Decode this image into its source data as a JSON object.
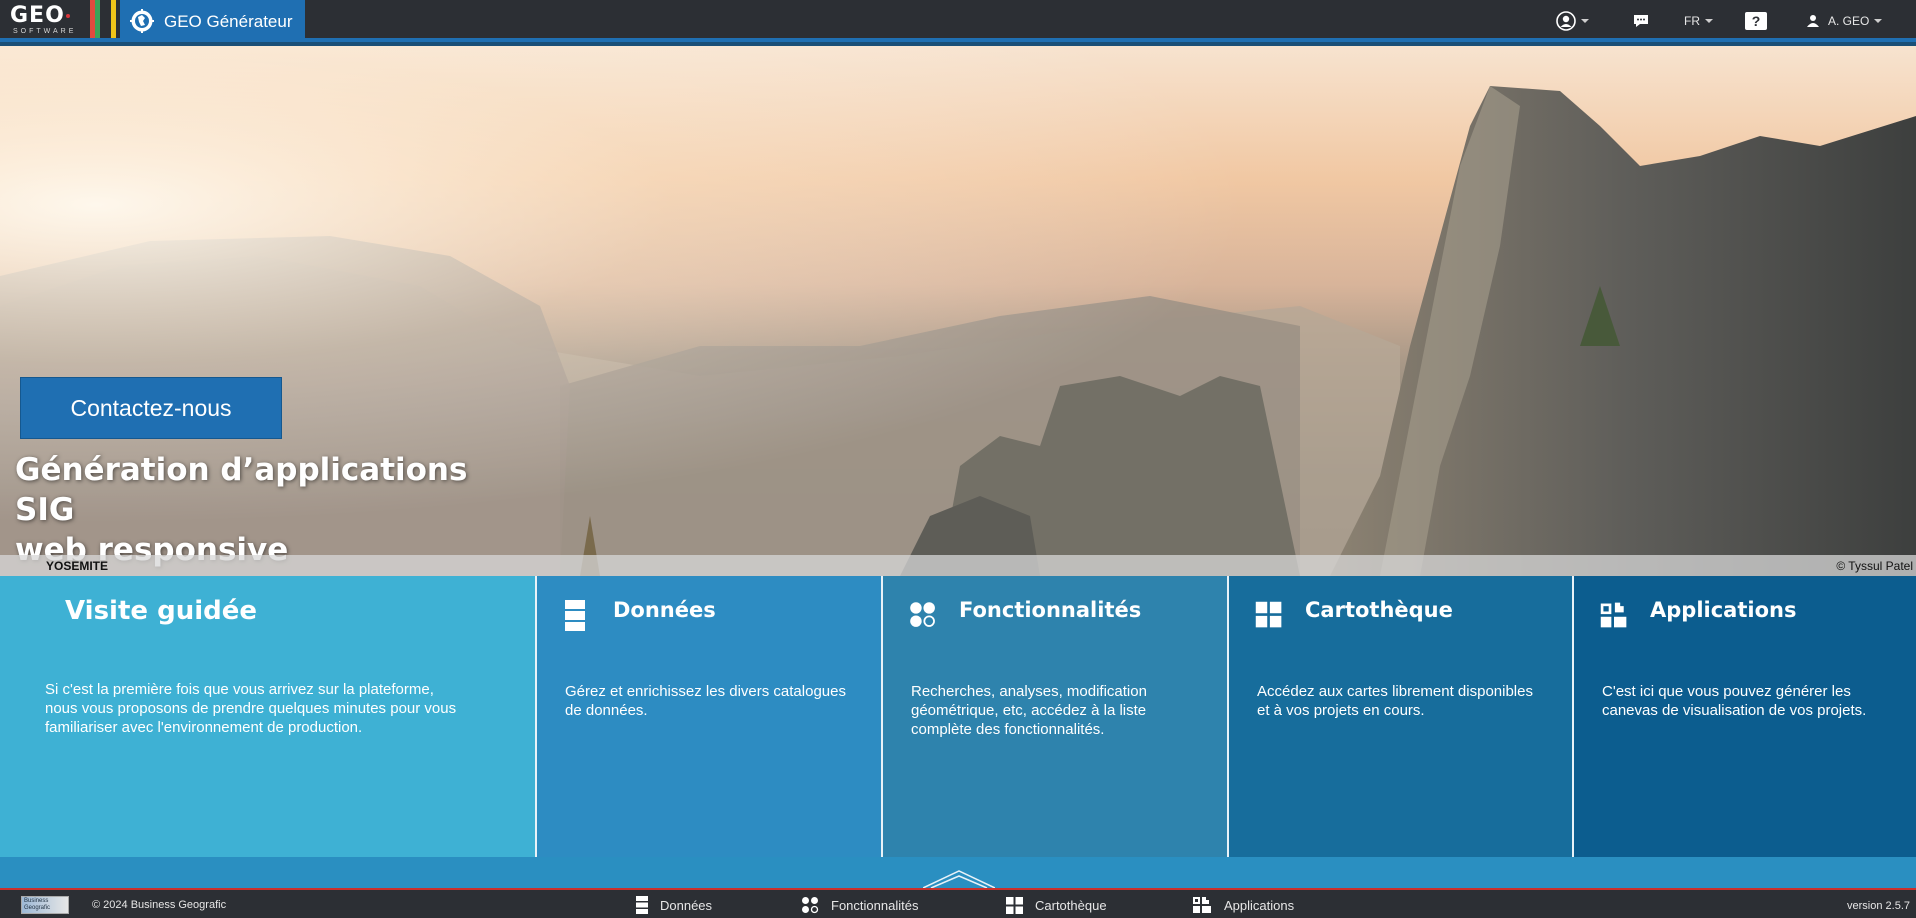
{
  "app": {
    "logo_text": "GEO",
    "logo_subtitle": "SOFTWARE",
    "brand_title": "GEO Générateur",
    "stripe_colors": [
      "#e04a3f",
      "#3aa35a",
      "#2c2f34",
      "#f0c419"
    ],
    "accent_color": "#1f6fb2"
  },
  "topbar": {
    "support_icon": "support-user-icon",
    "chat_icon": "chat-icon",
    "language": "FR",
    "help_label": "?",
    "user_name": "A. GEO"
  },
  "hero": {
    "contact_label": "Contactez-nous",
    "title_line1": "Génération d’applications SIG",
    "title_line2": "web responsive",
    "caption_location": "YOSEMITE",
    "caption_credit": "© Tyssul Patel"
  },
  "tiles": [
    {
      "key": "visit",
      "title": "Visite guidée",
      "description": "Si c'est la première fois que vous arrivez sur la plateforme, nous vous proposons de prendre quelques minutes pour vous familiariser avec l'environnement de production.",
      "color": "#3eb1d4",
      "icon": ""
    },
    {
      "key": "data",
      "title": "Données",
      "description": "Gérez et enrichissez les divers catalogues de données.",
      "color": "#2d8cc2",
      "icon": "database-icon"
    },
    {
      "key": "features",
      "title": "Fonctionnalités",
      "description": "Recherches, analyses, modification géométrique, etc, accédez à la liste complète des fonctionnalités.",
      "color": "#2e83ad",
      "icon": "features-icon"
    },
    {
      "key": "maps",
      "title": "Cartothèque",
      "description": "Accédez aux cartes librement disponibles et à vos projets en cours.",
      "color": "#176d9c",
      "icon": "grid-icon"
    },
    {
      "key": "apps",
      "title": "Applications",
      "description": "C'est ici que vous pouvez générer les canevas de visualisation de vos projets.",
      "color": "#0c5d8f",
      "icon": "apps-icon"
    }
  ],
  "footer": {
    "logo_text": "Business Geografic",
    "copyright": "© 2024 Business Geografic",
    "links": [
      "Données",
      "Fonctionnalités",
      "Cartothèque",
      "Applications"
    ],
    "version": "version 2.5.7"
  }
}
